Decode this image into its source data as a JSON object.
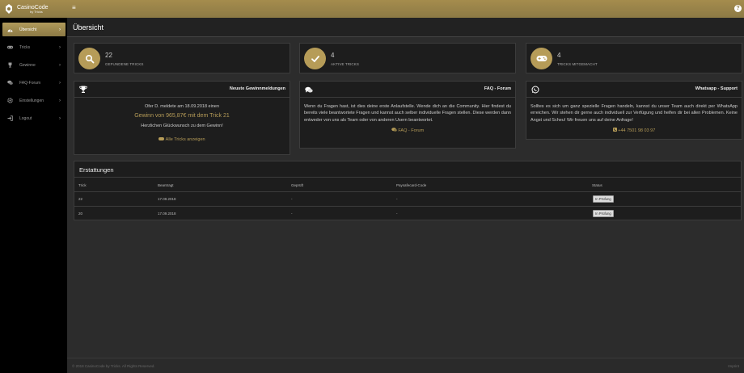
{
  "brand": {
    "title": "CasinoCode",
    "subtitle": "by Tricks"
  },
  "colors": {
    "accent": "#b69c58",
    "topbar": "#8c7a45",
    "sidebar": "#000000",
    "panel": "#1d1d1d"
  },
  "sidebar": {
    "items": [
      {
        "label": "Übersicht",
        "icon": "dashboard-icon",
        "active": true
      },
      {
        "label": "Tricks",
        "icon": "gamepad-icon"
      },
      {
        "label": "Gewinne",
        "icon": "trophy-icon"
      },
      {
        "label": "FAQ-Forum",
        "icon": "comments-icon"
      },
      {
        "label": "Einstellungen",
        "icon": "gear-icon"
      },
      {
        "label": "Logout",
        "icon": "logout-icon"
      }
    ]
  },
  "page": {
    "title": "Übersicht"
  },
  "stats": [
    {
      "value": "22",
      "label": "Gefundene Tricks",
      "icon": "search-icon"
    },
    {
      "value": "4",
      "label": "Aktive Tricks",
      "icon": "check-icon"
    },
    {
      "value": "4",
      "label": "Tricks mitgemacht",
      "icon": "gamepad-icon"
    }
  ],
  "wins": {
    "title": "Neuste Gewinnmeldungen",
    "line1": "Ofer D. meldete am 18.09.2018 einen",
    "line2": "Gewinn von 965,87€ mit dem Trick 21",
    "line3": "Herzlichen Glückwunsch zu dem Gewinn!",
    "link": "Alle Tricks anzeigen"
  },
  "faq": {
    "title": "FAQ - Forum",
    "text": "Wenn du Fragen hast, ist dies deine erste Anlaufstelle. Wende dich an die Community. Hier findest du bereits viele beantwortete Fragen und kannst auch selber individuelle Fragen stellen. Diese werden dann entweder von uns als Team oder von anderen Usern beantwortet.",
    "link": "FAQ - Forum"
  },
  "whatsapp": {
    "title": "Whatsapp - Support",
    "text": "Solltes es sich um ganz spezielle Fragen handeln, kannst du unser Team auch direkt per WhatsApp erreichen. Wir stehen dir gerne auch individuell zur Verfügung und helfen dir bei allen Problemen. Keine Angst und Scheu! Wir freuen uns auf deine Anfrage!",
    "phone": "+44 7501 98 03 97"
  },
  "refunds": {
    "title": "Erstattungen",
    "columns": [
      "Trick",
      "Beantragt",
      "Geprüft",
      "Paysafecard-Code",
      "Status"
    ],
    "rows": [
      [
        "22",
        "17.09.2018",
        "-",
        "-",
        "In Prüfung"
      ],
      [
        "20",
        "17.09.2018",
        "-",
        "-",
        "In Prüfung"
      ]
    ]
  },
  "footer": {
    "copyright": "© 2018 CasinoCode by Tricks. All Rights Reserved.",
    "imprint": "Imprint"
  }
}
